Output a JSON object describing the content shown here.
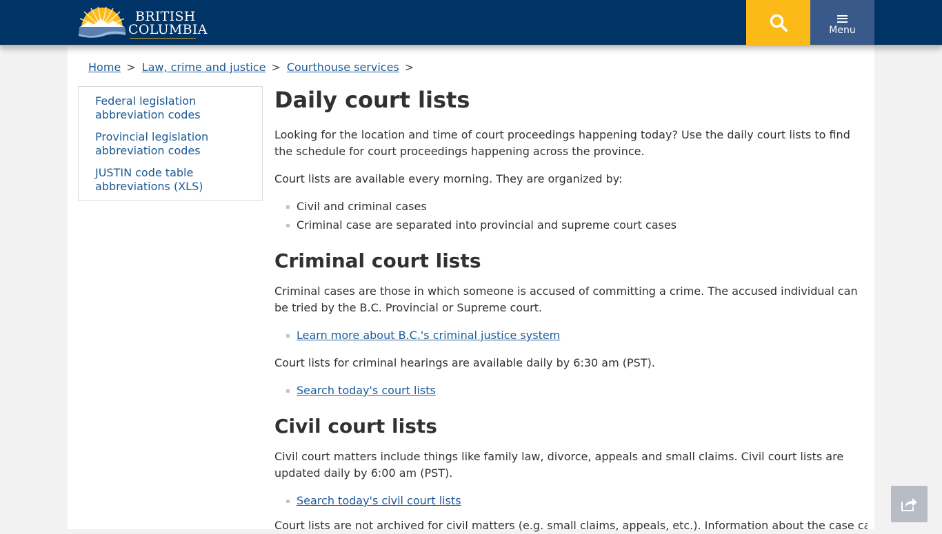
{
  "header": {
    "logo_line1": "British",
    "logo_line2": "Columbia",
    "search_icon": "magnifier-icon",
    "menu_label": "Menu",
    "colors": {
      "navy": "#003366",
      "gold": "#fcba19",
      "menu_bg": "#38598a"
    }
  },
  "breadcrumb": {
    "items": [
      {
        "label": "Home"
      },
      {
        "label": "Law, crime and justice"
      },
      {
        "label": "Courthouse services"
      }
    ],
    "separator": ">"
  },
  "sidenav": {
    "items": [
      {
        "label": "Federal legislation abbreviation codes"
      },
      {
        "label": "Provincial legislation abbreviation codes"
      },
      {
        "label": "JUSTIN code table abbreviations (XLS)"
      }
    ]
  },
  "main": {
    "title": "Daily court lists",
    "intro": "Looking for the location and time of court proceedings happening today?  Use the daily court lists to find the schedule for court proceedings happening across the province.",
    "availability": "Court lists are available every morning.  They are organized by:",
    "organized_by": [
      "Civil and criminal cases",
      "Criminal case are separated into provincial and supreme court cases"
    ],
    "criminal": {
      "heading": "Criminal court lists",
      "description": "Criminal cases are those in which someone is accused of committing a crime.  The accused individual can be tried by the B.C. Provincial or Supreme court.",
      "learn_more_link": "Learn more about B.C.'s criminal justice system",
      "timing": "Court lists for criminal hearings are available daily by 6:30 am (PST).",
      "search_link": "Search today's court lists"
    },
    "civil": {
      "heading": "Civil court lists",
      "description": "Civil court matters include things like family law, divorce, appeals and small claims.  Civil court lists are updated daily by 6:00 am (PST).",
      "search_link": "Search today's civil court lists",
      "archive_note": "Court lists are not archived for civil matters (e.g. small claims, appeals, etc.). Information about the case can be"
    }
  },
  "share": {
    "icon": "share-icon"
  }
}
